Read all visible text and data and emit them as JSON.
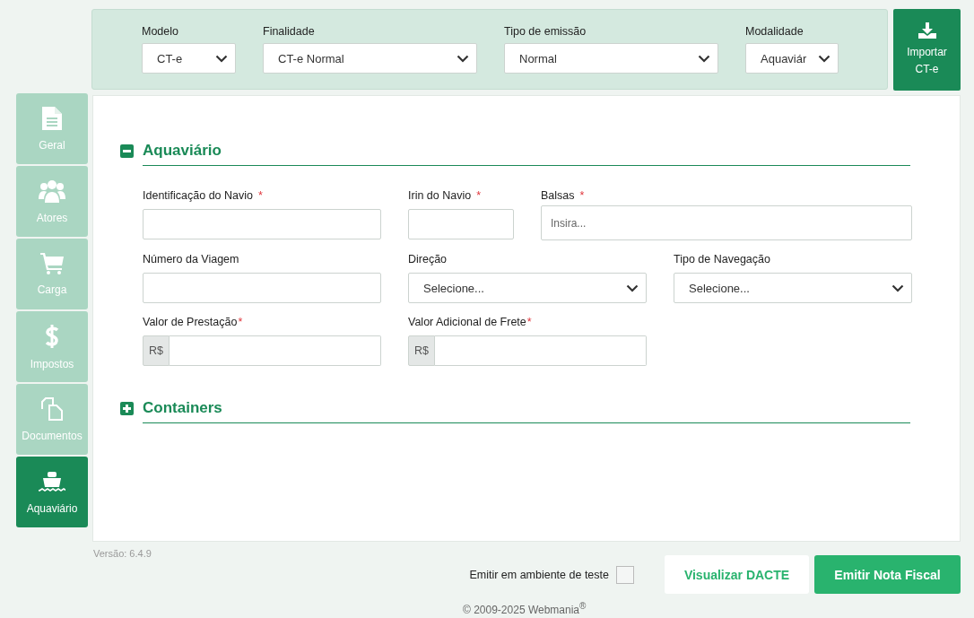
{
  "top_bar": {
    "fields": [
      {
        "label": "Modelo",
        "value": "CT-e"
      },
      {
        "label": "Finalidade",
        "value": "CT-e Normal"
      },
      {
        "label": "Tipo de emissão",
        "value": "Normal"
      },
      {
        "label": "Modalidade",
        "value": "Aquaviár"
      }
    ],
    "import_button": {
      "label": "Importar CT-e"
    }
  },
  "sidebar": {
    "items": [
      {
        "label": "Geral",
        "selected": false
      },
      {
        "label": "Atores",
        "selected": false
      },
      {
        "label": "Carga",
        "selected": false
      },
      {
        "label": "Impostos",
        "selected": false
      },
      {
        "label": "Documentos",
        "selected": false
      },
      {
        "label": "Aquaviário",
        "selected": true
      }
    ]
  },
  "sections": [
    {
      "title": "Aquaviário",
      "expanded": true,
      "rows": [
        [
          {
            "label": "Identificação do Navio",
            "required_mark": "*",
            "kind": "text"
          },
          {
            "label": "Irin do Navio",
            "required_mark": "*",
            "kind": "text"
          },
          {
            "label": "Balsas",
            "required_mark": "*",
            "kind": "text",
            "placeholder": "Insira..."
          }
        ],
        [
          {
            "label": "Número da Viagem",
            "kind": "text"
          },
          {
            "label": "Direção",
            "kind": "select",
            "value": "Selecione..."
          },
          {
            "label": "Tipo de Navegação",
            "kind": "select",
            "value": "Selecione..."
          }
        ],
        [
          {
            "label": "Valor de Prestação",
            "required_mark": "*",
            "kind": "money",
            "prefix": "R$"
          },
          {
            "label": "Valor Adicional de Frete",
            "required_mark": "*",
            "kind": "money",
            "prefix": "R$"
          }
        ]
      ]
    },
    {
      "title": "Containers",
      "expanded": false
    }
  ],
  "footer": {
    "version": "Versão: 6.4.9",
    "test_mode": {
      "label": "Emitir em ambiente de teste",
      "checked": false
    },
    "buttons": [
      {
        "label": "Visualizar DACTE",
        "kind": "secondary"
      },
      {
        "label": "Emitir Nota Fiscal",
        "kind": "primary"
      }
    ],
    "copyright": "© 2009-2025 Webmania$^{®}$"
  }
}
